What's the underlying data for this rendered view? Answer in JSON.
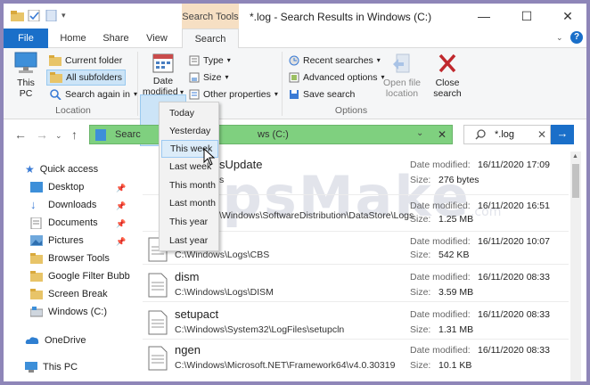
{
  "window": {
    "title": "*.log - Search Results in Windows (C:)",
    "context_tab": "Search Tools",
    "controls": [
      "—",
      "☐",
      "✕"
    ]
  },
  "tabs": [
    {
      "label": "File"
    },
    {
      "label": "Home"
    },
    {
      "label": "Share"
    },
    {
      "label": "View"
    },
    {
      "label": "Search"
    }
  ],
  "ribbon": {
    "this_pc": "This\nPC",
    "current_folder": "Current folder",
    "all_subfolders": "All subfolders",
    "search_again_in": "Search again in",
    "location_group": "Location",
    "date_modified": "Date\nmodified",
    "kind": "Type",
    "size": "Size",
    "other_properties": "Other properties",
    "recent_searches": "Recent searches",
    "advanced_options": "Advanced options",
    "save_search": "Save search",
    "open_file_location": "Open file\nlocation",
    "close_search": "Close\nsearch",
    "options_group": "Options"
  },
  "address": {
    "text": "Search Results in Windows (C:)",
    "visible_prefix": "Searc",
    "visible_suffix": "ws (C:)"
  },
  "search": {
    "query": "*.log"
  },
  "date_menu": {
    "items": [
      "Today",
      "Yesterday",
      "This week",
      "Last week",
      "This month",
      "Last month",
      "This year",
      "Last year"
    ],
    "hovered": "This week"
  },
  "nav": {
    "quick_access": "Quick access",
    "items": [
      {
        "label": "Desktop",
        "pinned": true
      },
      {
        "label": "Downloads",
        "pinned": true
      },
      {
        "label": "Documents",
        "pinned": true
      },
      {
        "label": "Pictures",
        "pinned": true
      },
      {
        "label": "Browser Tools",
        "pinned": false
      },
      {
        "label": "Google Filter Bubble",
        "pinned": false
      },
      {
        "label": "Screen Break",
        "pinned": false
      },
      {
        "label": "Windows (C:)",
        "pinned": false
      }
    ],
    "onedrive": "OneDrive",
    "this_pc": "This PC"
  },
  "files": [
    {
      "name": "sUpdate",
      "path": "s",
      "date": "16/11/2020 17:09",
      "size": "276 bytes"
    },
    {
      "name": "",
      "path": "\\Windows\\SoftwareDistribution\\DataStore\\Logs",
      "date": "16/11/2020 16:51",
      "size": "1.25 MB"
    },
    {
      "name": "",
      "path": "C:\\Windows\\Logs\\CBS",
      "date": "16/11/2020 10:07",
      "size": "542 KB"
    },
    {
      "name": "dism",
      "path": "C:\\Windows\\Logs\\DISM",
      "date": "16/11/2020 08:33",
      "size": "3.59 MB"
    },
    {
      "name": "setupact",
      "path": "C:\\Windows\\System32\\LogFiles\\setupcln",
      "date": "16/11/2020 08:33",
      "size": "1.31 MB"
    },
    {
      "name": "ngen",
      "path": "C:\\Windows\\Microsoft.NET\\Framework64\\v4.0.30319",
      "date": "16/11/2020 08:33",
      "size": "10.1 KB"
    }
  ],
  "labels": {
    "date_modified": "Date modified:",
    "size": "Size:"
  },
  "watermark": {
    "text": "TipsMake",
    "suffix": ".com"
  },
  "colors": {
    "accent": "#1a6fc9",
    "address_highlight": "#7fd07f",
    "context_tab": "#f6dfc3"
  }
}
